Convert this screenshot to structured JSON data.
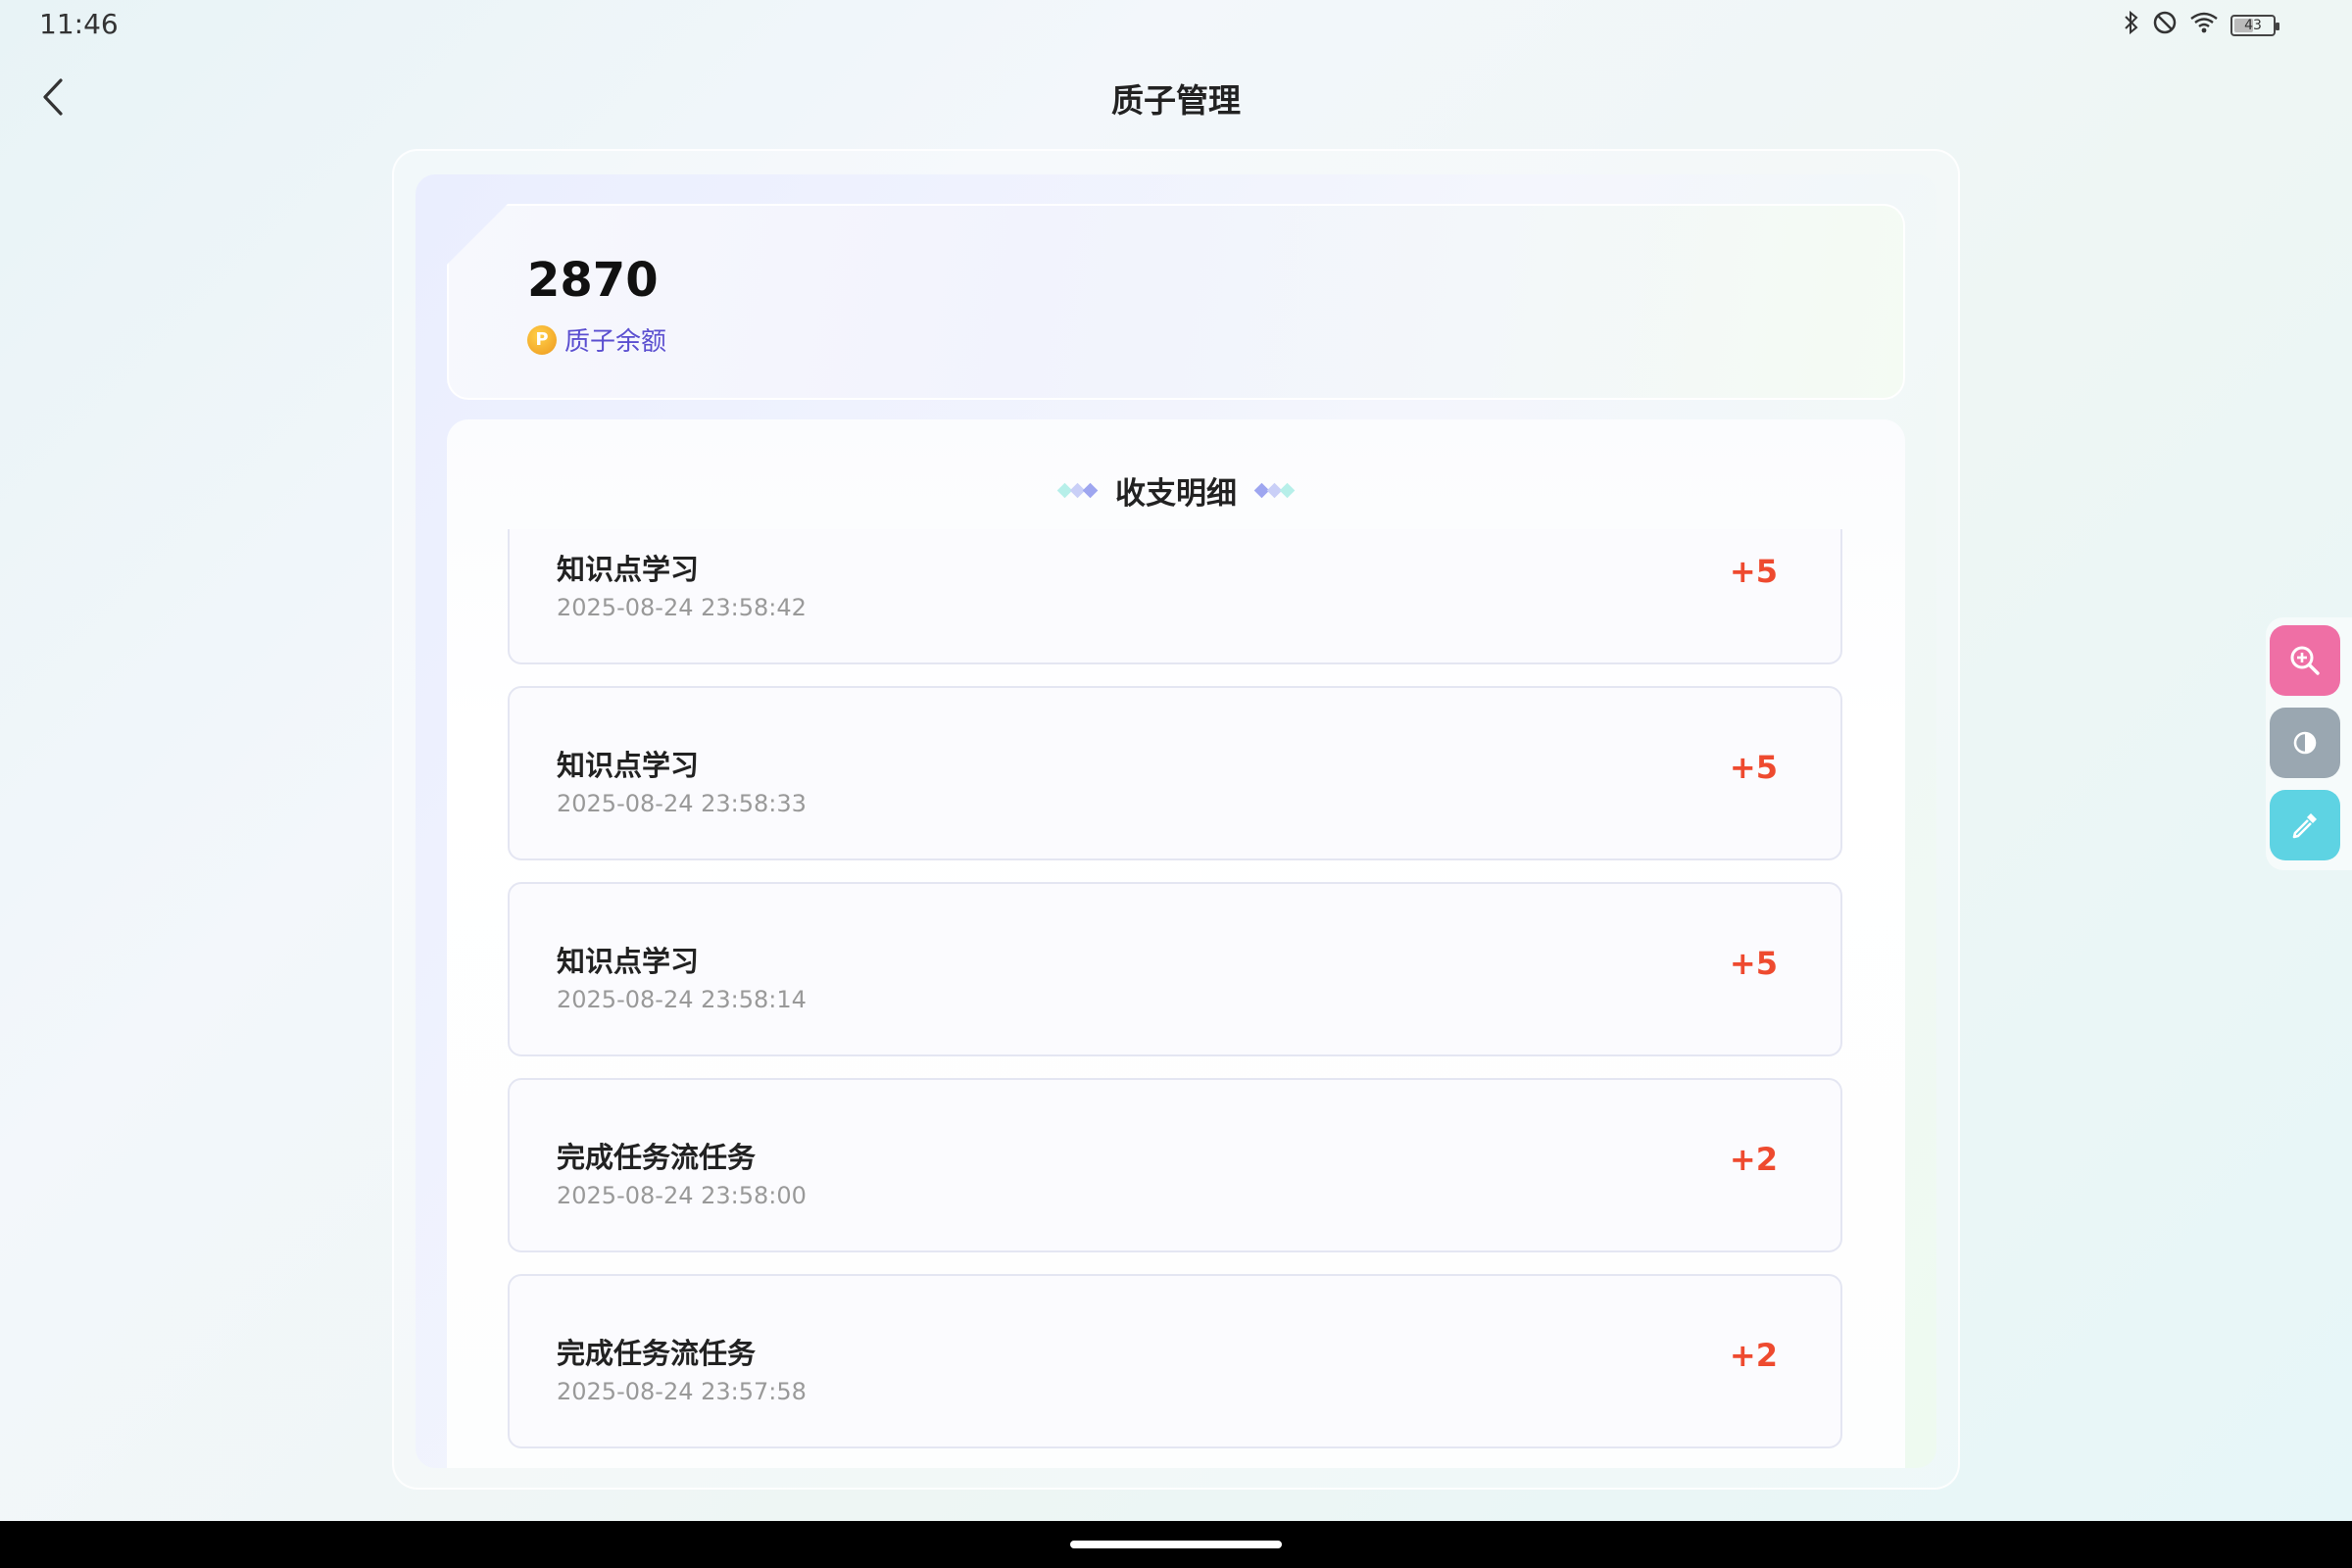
{
  "status_bar": {
    "time": "11:46",
    "battery_level": "43",
    "icons": [
      "bluetooth-icon",
      "dnd-icon",
      "wifi-icon",
      "battery-icon"
    ]
  },
  "header": {
    "title": "质子管理",
    "back_icon": "chevron-left-icon"
  },
  "balance": {
    "value": "2870",
    "label": "质子余额",
    "coin_glyph": "P"
  },
  "details": {
    "title": "收支明细",
    "items": [
      {
        "title": "知识点学习",
        "time": "2025-08-24 23:58:42",
        "amount": "+5"
      },
      {
        "title": "知识点学习",
        "time": "2025-08-24 23:58:33",
        "amount": "+5"
      },
      {
        "title": "知识点学习",
        "time": "2025-08-24 23:58:14",
        "amount": "+5"
      },
      {
        "title": "完成任务流任务",
        "time": "2025-08-24 23:58:00",
        "amount": "+2"
      },
      {
        "title": "完成任务流任务",
        "time": "2025-08-24 23:57:58",
        "amount": "+2"
      }
    ]
  },
  "float_tools": [
    {
      "name": "zoom-in-icon",
      "color": "#ef6fa5"
    },
    {
      "name": "contrast-icon",
      "color": "#9aa7b1"
    },
    {
      "name": "eyedropper-icon",
      "color": "#5ed3e3"
    }
  ],
  "colors": {
    "amount": "#ee4a2f",
    "balance_label": "#5b4fd0"
  }
}
